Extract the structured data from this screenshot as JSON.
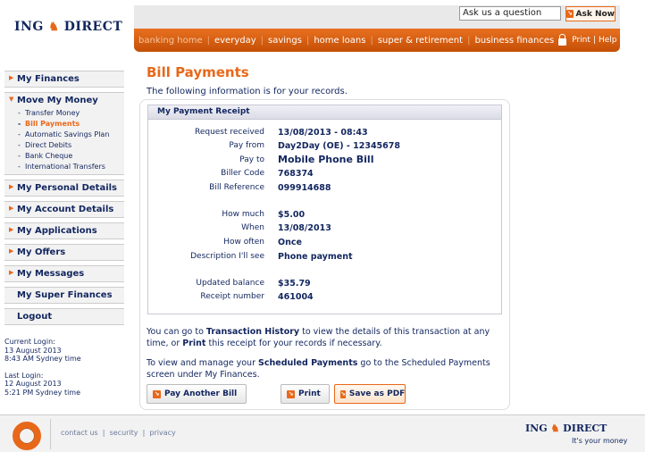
{
  "brand": {
    "name_left": "ING",
    "name_right": "DIRECT",
    "tagline": "It's your money",
    "accent": "#e8681a",
    "navy": "#12265f"
  },
  "header": {
    "search_value": "Ask us a question",
    "ask_button": "Ask Now",
    "nav": [
      "banking home",
      "everyday",
      "savings",
      "home loans",
      "super & retirement",
      "business finances"
    ],
    "util": {
      "print": "Print",
      "help": "Help",
      "logout": "Logout"
    }
  },
  "sidebar": {
    "sections": [
      {
        "label": "My Finances"
      },
      {
        "label": "Move My Money",
        "items": [
          "Transfer Money",
          "Bill Payments",
          "Automatic Savings Plan",
          "Direct Debits",
          "Bank Cheque",
          "International Transfers"
        ]
      },
      {
        "label": "My Personal Details"
      },
      {
        "label": "My Account Details"
      },
      {
        "label": "My Applications"
      },
      {
        "label": "My Offers"
      },
      {
        "label": "My Messages"
      },
      {
        "label": "My Super Finances"
      },
      {
        "label": "Logout"
      }
    ],
    "current_login": {
      "label": "Current Login:",
      "date": "13 August 2013",
      "time": "8:43 AM Sydney time"
    },
    "last_login": {
      "label": "Last Login:",
      "date": "12 August 2013",
      "time": "5:21 PM Sydney time"
    }
  },
  "main": {
    "title": "Bill Payments",
    "intro": "The following information is for your records.",
    "receipt": {
      "title": "My Payment Receipt",
      "fields": [
        {
          "label": "Request received",
          "value": "13/08/2013 - 08:43"
        },
        {
          "label": "Pay from",
          "value": "Day2Day (OE) - 12345678"
        },
        {
          "label": "Pay to",
          "value": "Mobile Phone Bill"
        },
        {
          "label": "Biller Code",
          "value": "768374"
        },
        {
          "label": "Bill Reference",
          "value": "099914688"
        },
        {
          "label": "How much",
          "value": "$5.00"
        },
        {
          "label": "When",
          "value": "13/08/2013"
        },
        {
          "label": "How often",
          "value": "Once"
        },
        {
          "label": "Description I'll see",
          "value": "Phone payment"
        },
        {
          "label": "Updated balance",
          "value": "$35.79"
        },
        {
          "label": "Receipt number",
          "value": "461004"
        }
      ]
    },
    "para1": {
      "pre": "You can go to ",
      "link1": "Transaction History",
      "mid": " to view the details of this transaction at any time, or ",
      "link2": "Print",
      "post": " this receipt for your records if necessary."
    },
    "para2": {
      "pre": "To view and manage your ",
      "link": "Scheduled Payments",
      "post": " go to the Scheduled Payments screen under My Finances."
    },
    "buttons": {
      "pay_another": "Pay Another Bill",
      "print": "Print",
      "pdf": "Save as PDF"
    }
  },
  "footer": {
    "links": [
      "contact us",
      "security",
      "privacy"
    ]
  }
}
